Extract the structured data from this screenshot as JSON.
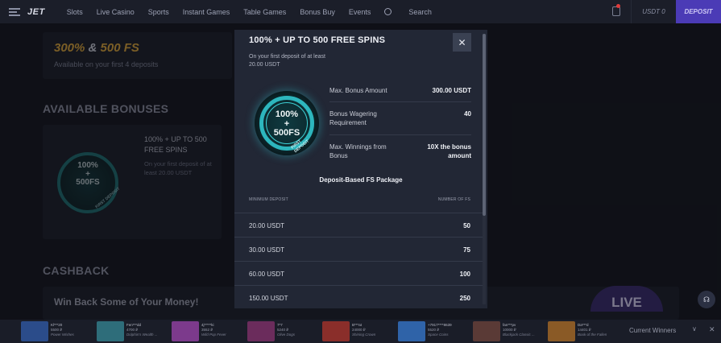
{
  "header": {
    "logo": "JET",
    "nav": [
      "Slots",
      "Live Casino",
      "Sports",
      "Instant Games",
      "Table Games",
      "Bonus Buy",
      "Events"
    ],
    "search_label": "Search",
    "balance": "USDT 0",
    "deposit_label": "DEPOSIT"
  },
  "background": {
    "welcome_title_a": "300%",
    "welcome_title_b": " & ",
    "welcome_title_c": "500 FS",
    "welcome_sub": "Available on your first 4 deposits",
    "available_title": "AVAILABLE BONUSES",
    "card_badge_line1": "100%",
    "card_badge_line2": "+",
    "card_badge_line3": "500FS",
    "card_badge_arc": "FIRST DEPOSIT",
    "card_title": "100% + UP TO 500 FREE SPINS",
    "card_sub": "On your first deposit of at least 20.00 USDT",
    "cashback_title": "CASHBACK",
    "cashback_sub": "Win Back Some of Your Money!",
    "live_label": "LIVE"
  },
  "modal": {
    "title": "100% + UP TO 500 FREE SPINS",
    "subtitle": "On your first deposit of at least 20.00 USDT",
    "badge_line1": "100%",
    "badge_line2": "+",
    "badge_line3": "500FS",
    "badge_arc": "FIRST DEPOSIT",
    "info": [
      {
        "label": "Max. Bonus Amount",
        "value": "300.00 USDT"
      },
      {
        "label": "Bonus Wagering Requirement",
        "value": "40"
      },
      {
        "label": "Max. Winnings from Bonus",
        "value": "10X the bonus amount"
      }
    ],
    "package_title": "Deposit-Based FS Package",
    "col_deposit": "MINIMUM DEPOSIT",
    "col_fs": "NUMBER OF FS",
    "rows": [
      {
        "deposit": "20.00 USDT",
        "fs": "50"
      },
      {
        "deposit": "30.00 USDT",
        "fs": "75"
      },
      {
        "deposit": "60.00 USDT",
        "fs": "100"
      },
      {
        "deposit": "150.00 USDT",
        "fs": "250"
      }
    ]
  },
  "ticker": {
    "label": "Current Winners",
    "winners": [
      {
        "who": "Kl***20",
        "amt": "5500 ₽",
        "game": "Power Wishes",
        "color": "#2b4c8a"
      },
      {
        "who": "Fen***dd",
        "amt": "4700 ₽",
        "game": "Dolphin's Wealth ...",
        "color": "#2e6d7a"
      },
      {
        "who": "4j*****ki",
        "amt": "3552 ₽",
        "game": "Wild Pop Fever",
        "color": "#7c3a8c"
      },
      {
        "who": "7*7",
        "amt": "5240 ₽",
        "game": "Olive Dogs",
        "color": "#6b2c5c"
      },
      {
        "who": "B***at",
        "amt": "24000 ₽",
        "game": "Shining Crown",
        "color": "#8a2e2a"
      },
      {
        "who": "+7917****8639",
        "amt": "5520 ₽",
        "game": "Space Coins",
        "color": "#2f63a8"
      },
      {
        "who": "fan***pv",
        "amt": "10000 ₽",
        "game": "Blackjack Classic ...",
        "color": "#5a3a36"
      },
      {
        "who": "Da***d",
        "amt": "14401 ₽",
        "game": "Book of the Fallen",
        "color": "#8a5a26"
      }
    ]
  },
  "chat_icon": "headset-icon"
}
